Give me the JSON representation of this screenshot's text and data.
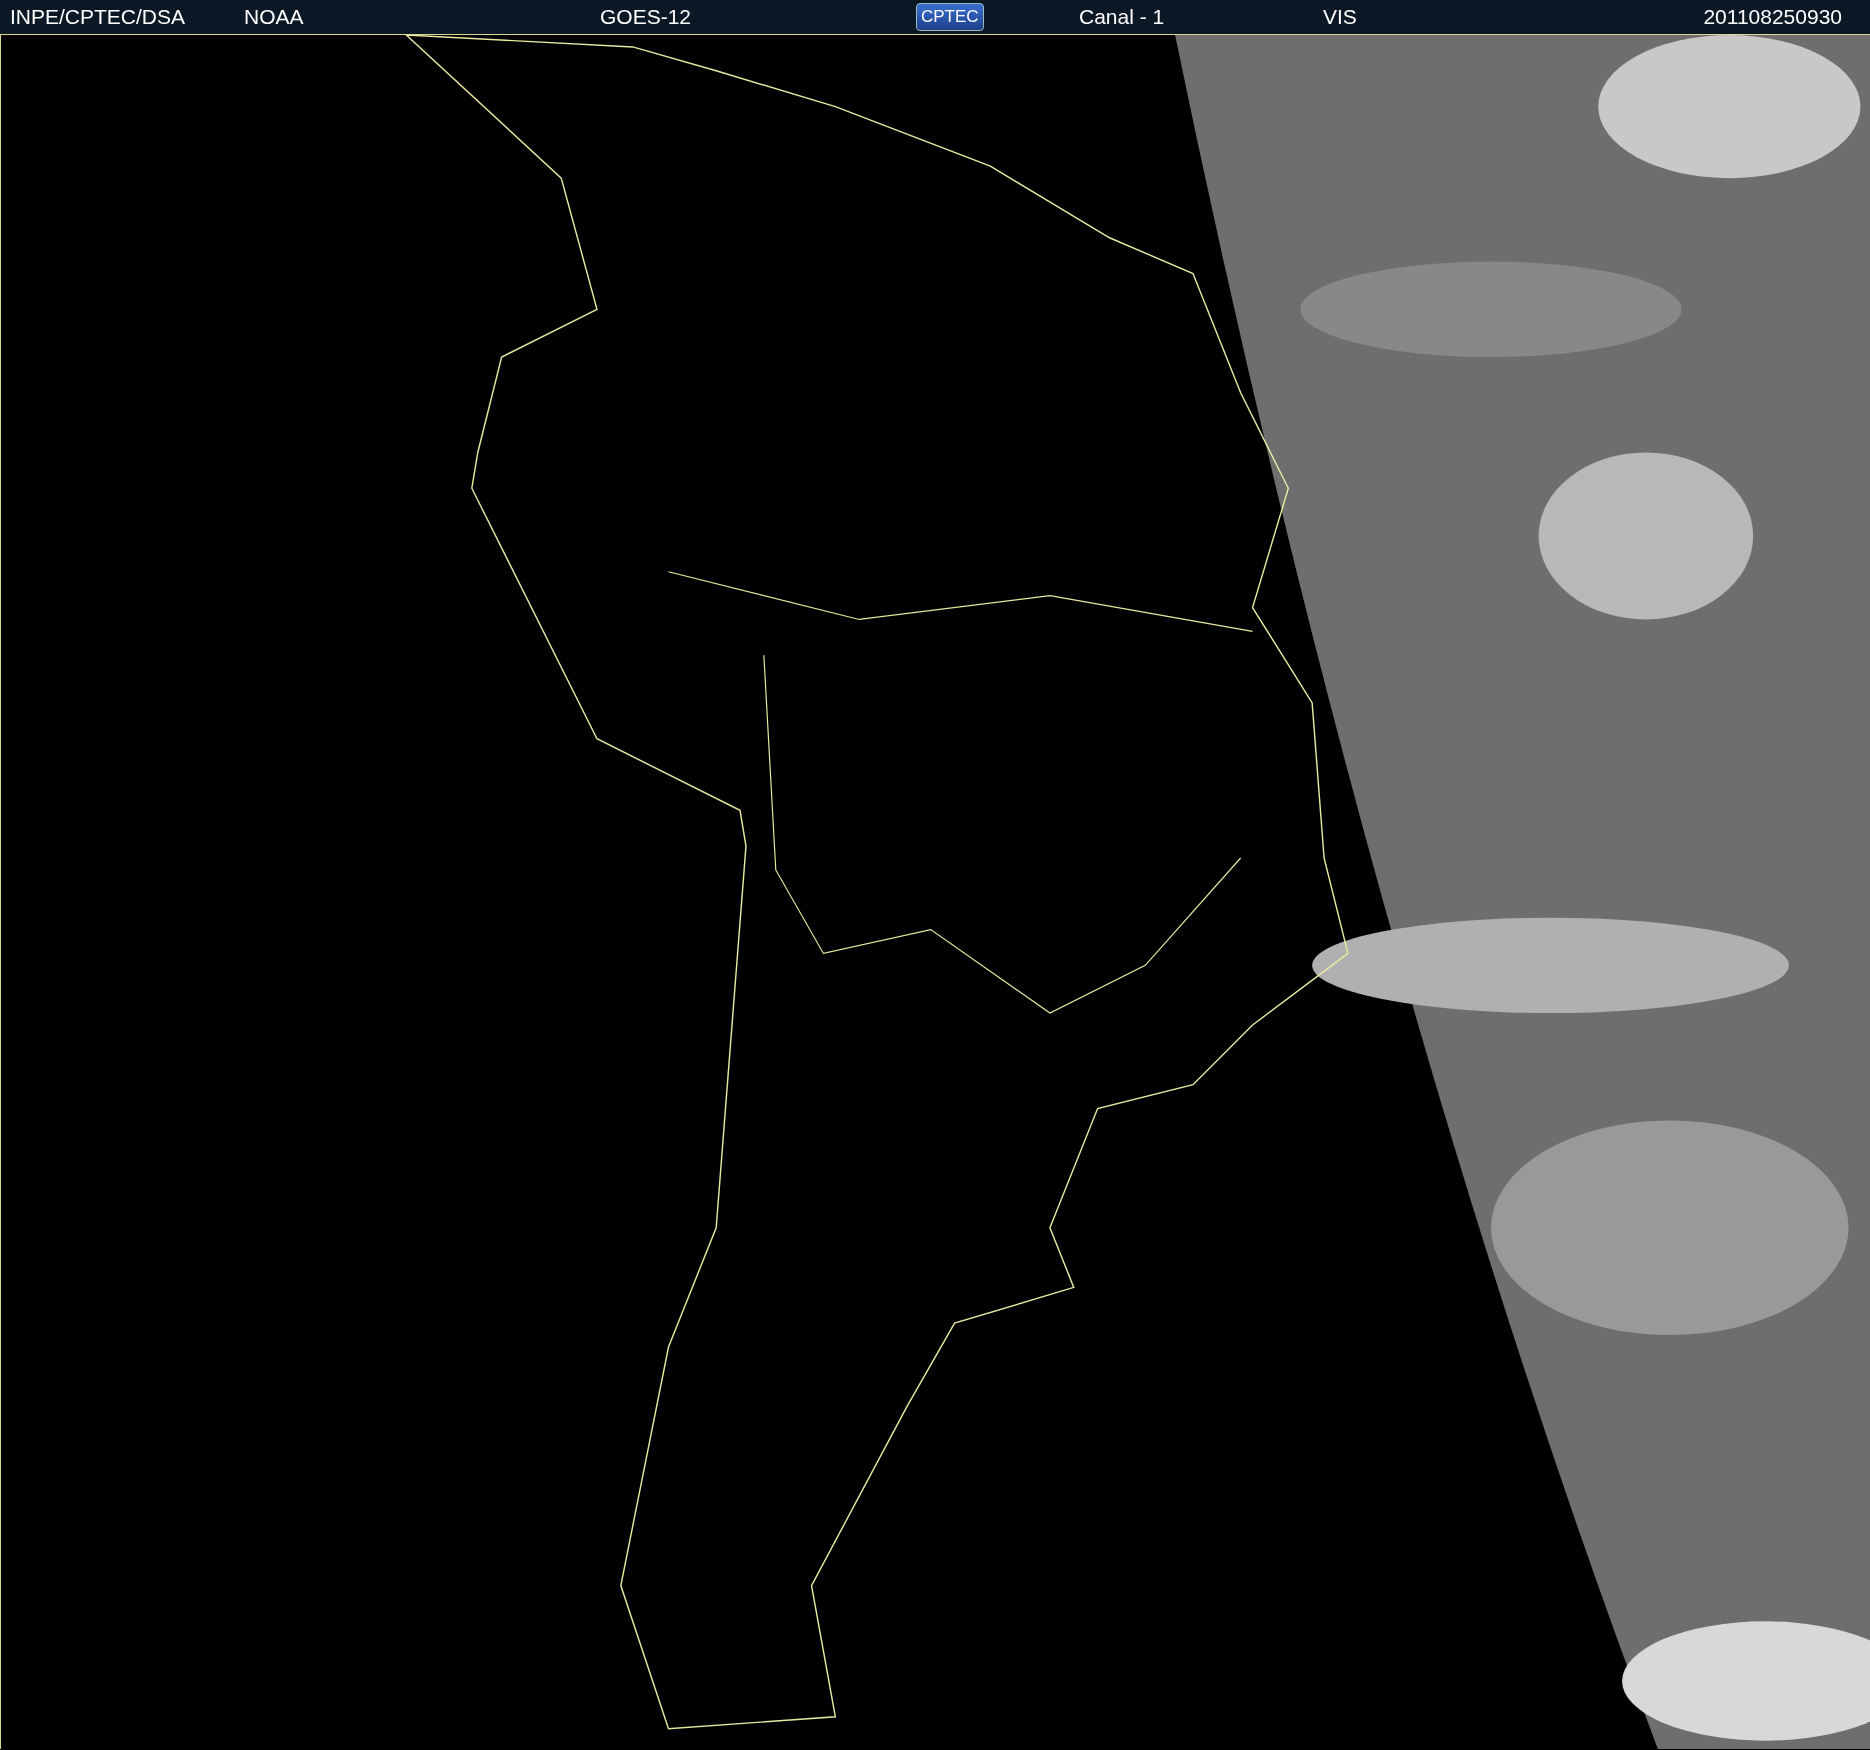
{
  "header": {
    "items": [
      {
        "kind": "text",
        "text": "INPE/CPTEC/DSA"
      },
      {
        "kind": "text",
        "text": "NOAA"
      },
      {
        "kind": "text",
        "text": "GOES-12"
      },
      {
        "kind": "logo",
        "text": "CPTEC"
      },
      {
        "kind": "text",
        "text": "Canal - 1"
      },
      {
        "kind": "text",
        "text": "VIS"
      },
      {
        "kind": "text",
        "text": "201108250930"
      }
    ]
  }
}
